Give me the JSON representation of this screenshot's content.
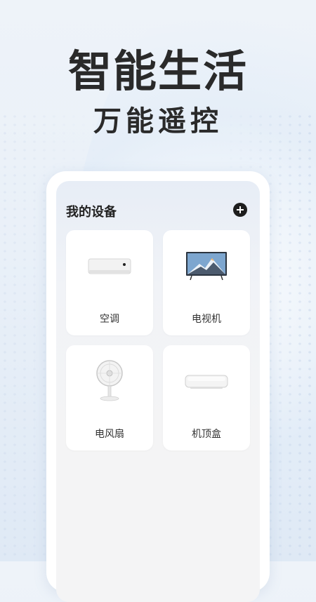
{
  "hero": {
    "title": "智能生活",
    "subtitle": "万能遥控"
  },
  "screen": {
    "title": "我的设备"
  },
  "devices": [
    {
      "label": "空调",
      "icon": "air-conditioner-icon"
    },
    {
      "label": "电视机",
      "icon": "television-icon"
    },
    {
      "label": "电风扇",
      "icon": "electric-fan-icon"
    },
    {
      "label": "机顶盒",
      "icon": "set-top-box-icon"
    }
  ],
  "colors": {
    "heading": "#2a2a2a",
    "add_button": "#1d1d1d",
    "card": "#ffffff"
  }
}
